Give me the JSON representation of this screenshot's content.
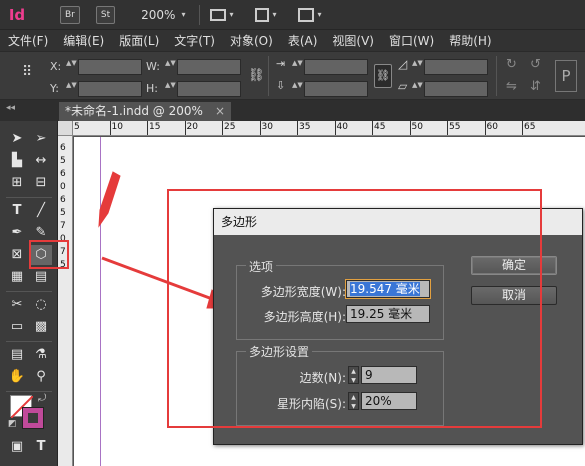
{
  "app": {
    "logo": "Id",
    "bridge_btn": "Br",
    "stock_btn": "St",
    "zoom": "200%",
    "zoom_arrow": "▾"
  },
  "menu": {
    "items": [
      "文件(F)",
      "编辑(E)",
      "版面(L)",
      "文字(T)",
      "对象(O)",
      "表(A)",
      "视图(V)",
      "窗口(W)",
      "帮助(H)"
    ]
  },
  "control": {
    "x_label": "X:",
    "y_label": "Y:",
    "w_label": "W:",
    "h_label": "H:",
    "p_label": "P"
  },
  "tab": {
    "title": "*未命名-1.indd @ 200%",
    "close": "×"
  },
  "ruler": {
    "h_ticks": [
      "5",
      "10",
      "15",
      "20",
      "25",
      "30",
      "35",
      "40",
      "45",
      "50",
      "55",
      "60",
      "65"
    ],
    "v_ticks": [
      "6",
      "5",
      "6",
      "0",
      "6",
      "5",
      "7",
      "0",
      "7",
      "5"
    ]
  },
  "dialog": {
    "title": "多边形",
    "options_group": "选项",
    "width_label": "多边形宽度(W):",
    "width_value": "19.547 毫米",
    "height_label": "多边形高度(H):",
    "height_value": "19.25 毫米",
    "settings_group": "多边形设置",
    "sides_label": "边数(N):",
    "sides_value": "9",
    "star_label": "星形内陷(S):",
    "star_value": "20%",
    "ok_button": "确定",
    "cancel_button": "取消"
  },
  "colors": {
    "annotation": "#e53b3b",
    "logo": "#ee3d8f",
    "selection": "#3a76d6"
  }
}
